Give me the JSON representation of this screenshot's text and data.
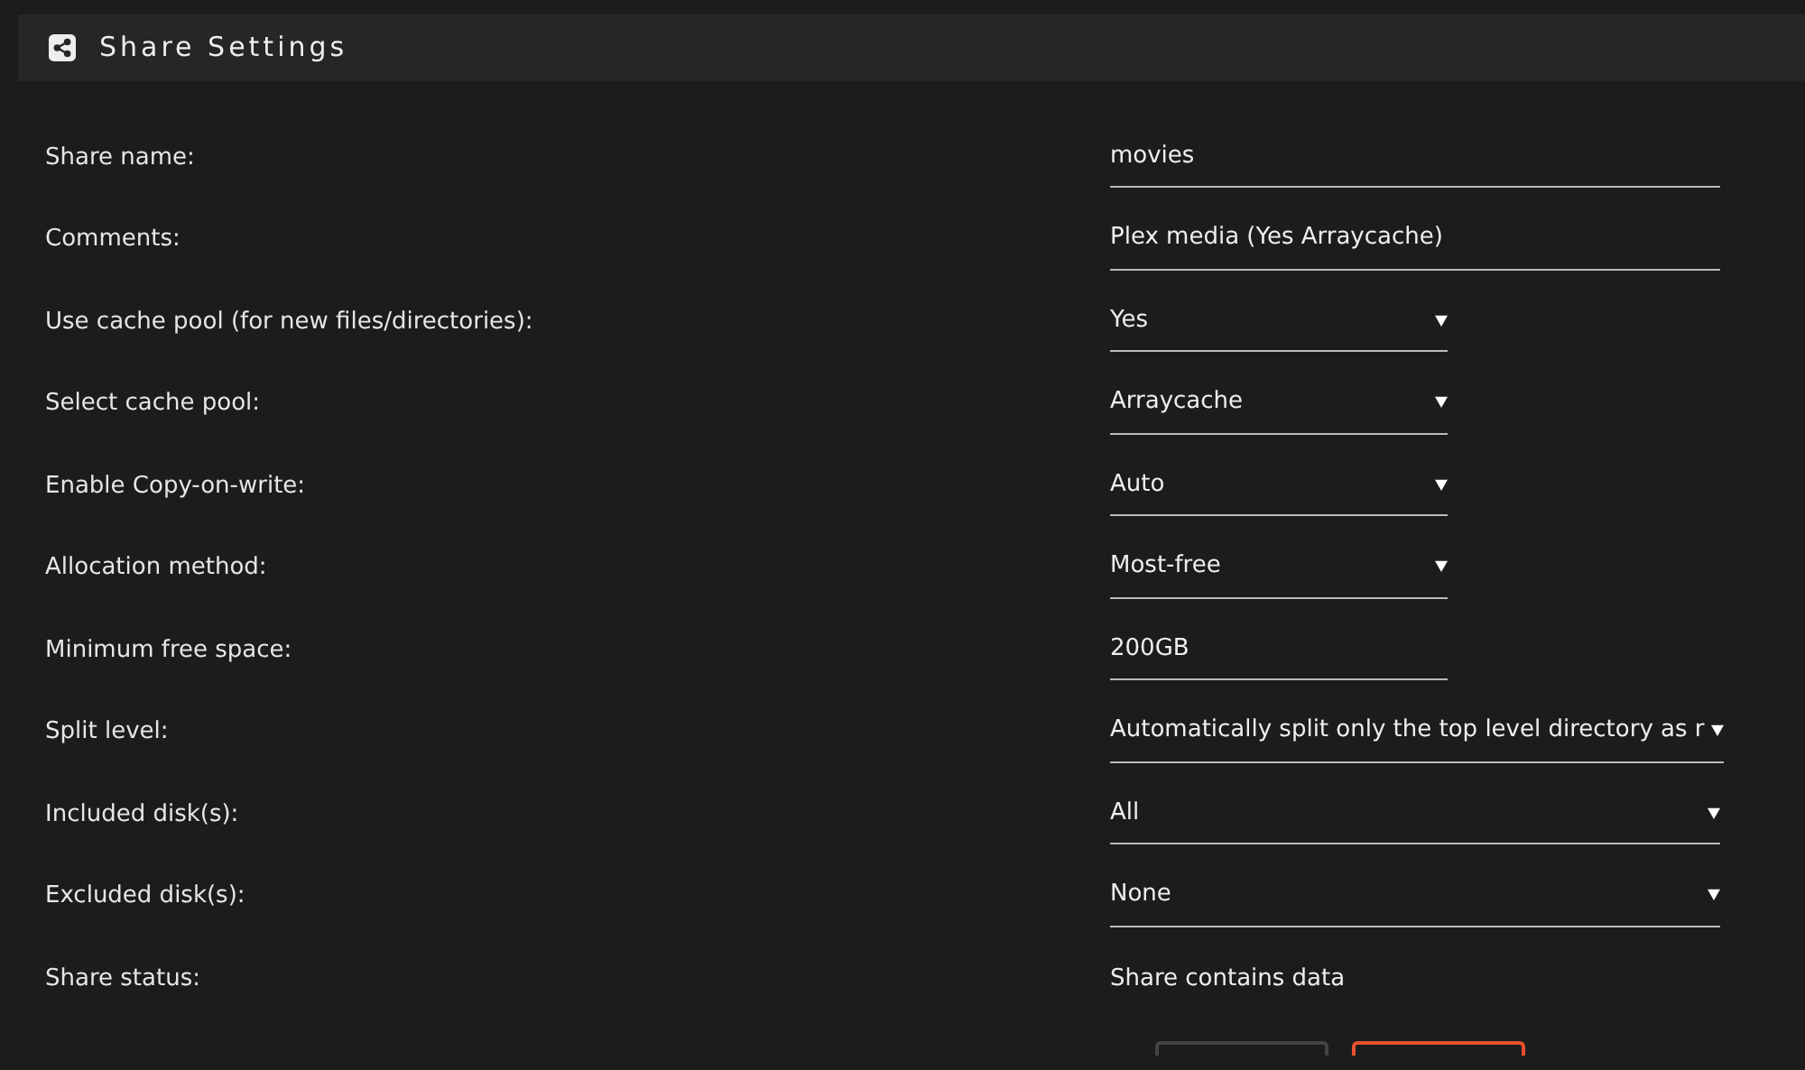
{
  "header": {
    "title": "Share Settings"
  },
  "settings": [
    {
      "label": "Share name:",
      "kind": "text",
      "value": "movies",
      "wide": true
    },
    {
      "label": "Comments:",
      "kind": "text",
      "value": "Plex media (Yes Arraycache)",
      "wide": true
    },
    {
      "label": "Use cache pool (for new files/directories):",
      "kind": "select",
      "value": "Yes",
      "wide": false
    },
    {
      "label": "Select cache pool:",
      "kind": "select",
      "value": "Arraycache",
      "wide": false
    },
    {
      "label": "Enable Copy-on-write:",
      "kind": "select",
      "value": "Auto",
      "wide": false
    },
    {
      "label": "Allocation method:",
      "kind": "select",
      "value": "Most-free",
      "wide": false
    },
    {
      "label": "Minimum free space:",
      "kind": "text",
      "value": "200GB",
      "wide": false
    },
    {
      "label": "Split level:",
      "kind": "select",
      "value": "Automatically split only the top level directory as r",
      "wide": true
    },
    {
      "label": "Included disk(s):",
      "kind": "select",
      "value": "All",
      "wide": true
    },
    {
      "label": "Excluded disk(s):",
      "kind": "select",
      "value": "None",
      "wide": true
    },
    {
      "label": "Share status:",
      "kind": "status",
      "value": "Share contains data"
    }
  ],
  "buttons": [
    {
      "kind": "plain"
    },
    {
      "kind": "danger"
    }
  ]
}
